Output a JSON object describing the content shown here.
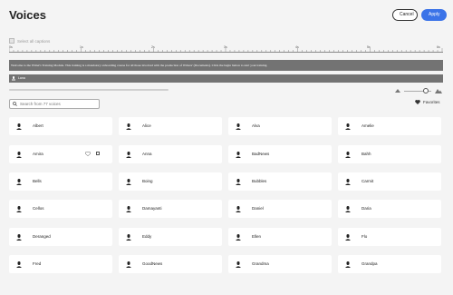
{
  "header": {
    "title": "Voices",
    "cancel_label": "Cancel",
    "apply_label": "Apply"
  },
  "select_all_label": "Select all captions",
  "ruler": {
    "ticks": [
      "0s",
      "1s",
      "2s",
      "3s",
      "4s",
      "5s",
      "6s"
    ]
  },
  "tracks": [
    {
      "text": "Welcome to the Writer's Training Module. This training is a mandatory onboarding course for all those involved with the production of Writers' (Documents). Click the begin button to start your training."
    },
    {
      "text": "Lana"
    }
  ],
  "search": {
    "placeholder": "Search from 77 voices"
  },
  "favorites_label": "Favorites",
  "voices": [
    [
      "Albert",
      "Alice",
      "Alva",
      "Amelie"
    ],
    [
      "Amira",
      "Anna",
      "BadNews",
      "Bahh"
    ],
    [
      "Bells",
      "Boing",
      "Bubbles",
      "Carmit"
    ],
    [
      "Cellos",
      "Damayanti",
      "Daniel",
      "Daria"
    ],
    [
      "Deranged",
      "Eddy",
      "Ellen",
      "Flo"
    ],
    [
      "Fred",
      "GoodNews",
      "Grandma",
      "Grandpa"
    ]
  ],
  "colors": {
    "accent": "#3b73e8",
    "track": "#737373",
    "background": "#f4f4f4"
  },
  "icons": {
    "voice": "voice-mic-icon",
    "favorite": "heart-icon",
    "search": "search-icon"
  }
}
